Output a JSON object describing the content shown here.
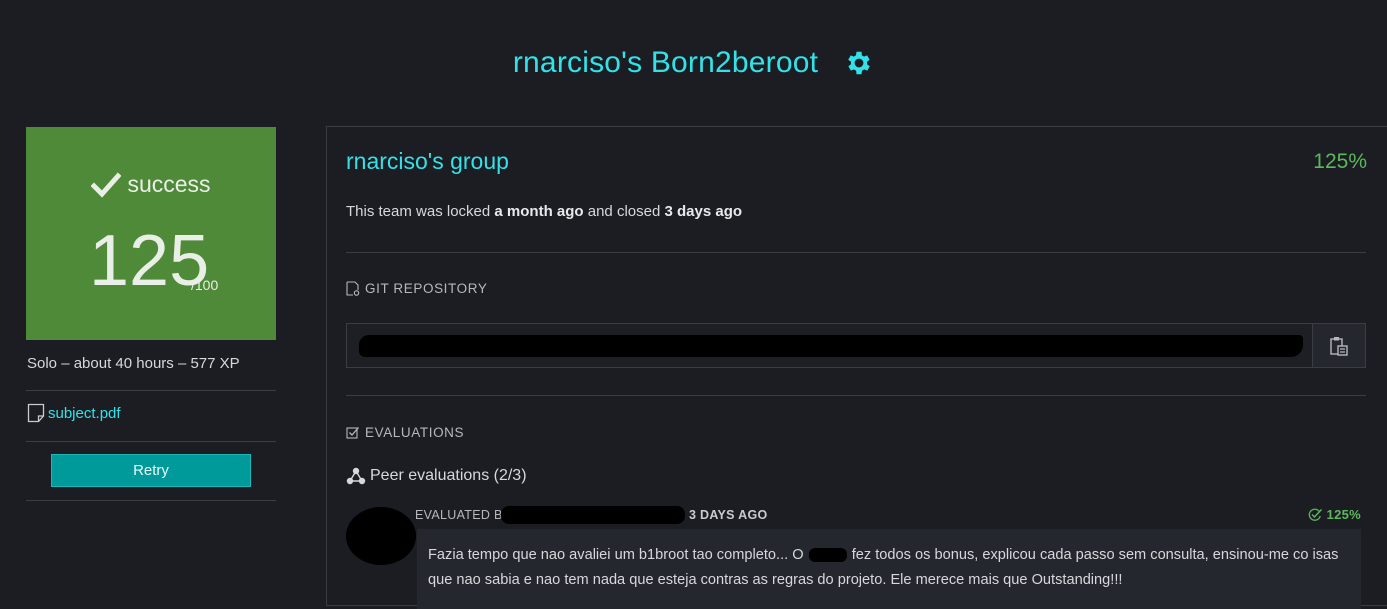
{
  "header": {
    "title": "rnarciso's Born2beroot"
  },
  "score_card": {
    "status": "success",
    "score": "125",
    "max": "/100",
    "accent": "#4f8a38"
  },
  "project": {
    "meta": "Solo – about 40 hours – 577 XP",
    "subject_link": "subject.pdf",
    "retry_label": "Retry"
  },
  "group": {
    "title": "rnarciso's group",
    "score": "125%",
    "lock_prefix": "This team was locked",
    "locked_when": "a month ago",
    "lock_mid": "and closed",
    "closed_when": "3 days ago"
  },
  "sections": {
    "git_label": "GIT REPOSITORY",
    "evaluations_label": "EVALUATIONS"
  },
  "peer": {
    "title": "Peer evaluations (2/3)"
  },
  "evaluation": {
    "by_label": "EVALUATED BY",
    "date": "3 DAYS AGO",
    "score": "125%",
    "comment_start": "Fazia tempo que nao avaliei um b1broot tao completo... O",
    "comment_end": "fez todos os bonus, explicou cada passo sem consulta, ensinou-me co isas que nao sabia e nao tem nada que esteja contras as regras do projeto. Ele merece mais que Outstanding!!!"
  },
  "colors": {
    "link": "#33e2e8",
    "success_text": "#5cb85c",
    "retry": "#009a9a",
    "background": "#1b1d22"
  }
}
